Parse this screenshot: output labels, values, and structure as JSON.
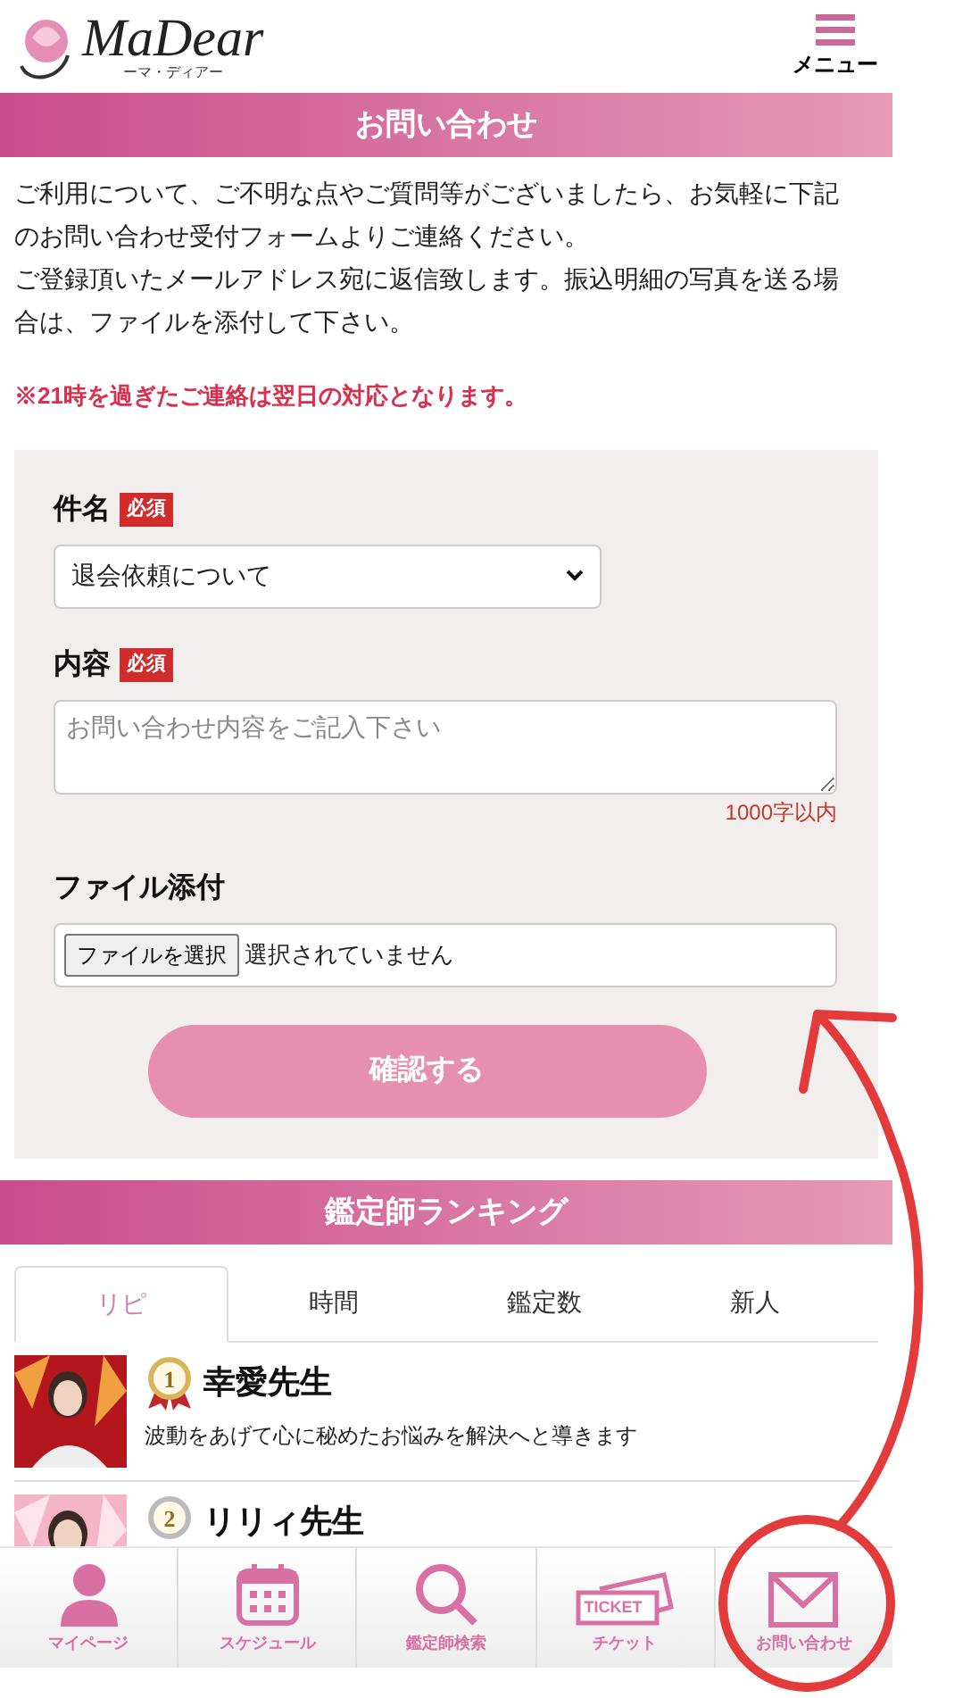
{
  "header": {
    "logo_text": "MaDear",
    "logo_subtitle": "ーマ・ディアー",
    "menu_label": "メニュー"
  },
  "contact": {
    "title": "お問い合わせ",
    "intro": [
      "ご利用について、ご不明な点やご質問等がございましたら、お気軽に下記のお問い合わせ受付フォームよりご連絡ください。",
      "ご登録頂いたメールアドレス宛に返信致します。振込明細の写真を送る場合は、ファイルを添付して下さい。"
    ],
    "notice": "※21時を過ぎたご連絡は翌日の対応となります。",
    "form": {
      "subject": {
        "label": "件名",
        "required_badge": "必須",
        "value": "退会依頼について"
      },
      "content": {
        "label": "内容",
        "required_badge": "必須",
        "placeholder": "お問い合わせ内容をご記入下さい",
        "limit": "1000字以内"
      },
      "attachment": {
        "label": "ファイル添付",
        "button": "ファイルを選択",
        "status": "選択されていません"
      },
      "submit": "確認する"
    }
  },
  "ranking": {
    "title": "鑑定師ランキング",
    "tabs": [
      {
        "label": "リピ",
        "selected": true
      },
      {
        "label": "時間",
        "selected": false
      },
      {
        "label": "鑑定数",
        "selected": false
      },
      {
        "label": "新人",
        "selected": false
      }
    ],
    "rows": [
      {
        "rank": "1",
        "name": "幸愛先生",
        "description": "波動をあげて心に秘めたお悩みを解決へと導きます"
      },
      {
        "rank": "2",
        "name": "リリィ先生"
      }
    ]
  },
  "bottom_nav": [
    {
      "kind": "person",
      "label": "マイページ"
    },
    {
      "kind": "calendar",
      "label": "スケジュール"
    },
    {
      "kind": "search",
      "label": "鑑定師検索"
    },
    {
      "kind": "ticket",
      "label": "チケット",
      "icon_text": "TICKET"
    },
    {
      "kind": "mail",
      "label": "お問い合わせ"
    }
  ]
}
